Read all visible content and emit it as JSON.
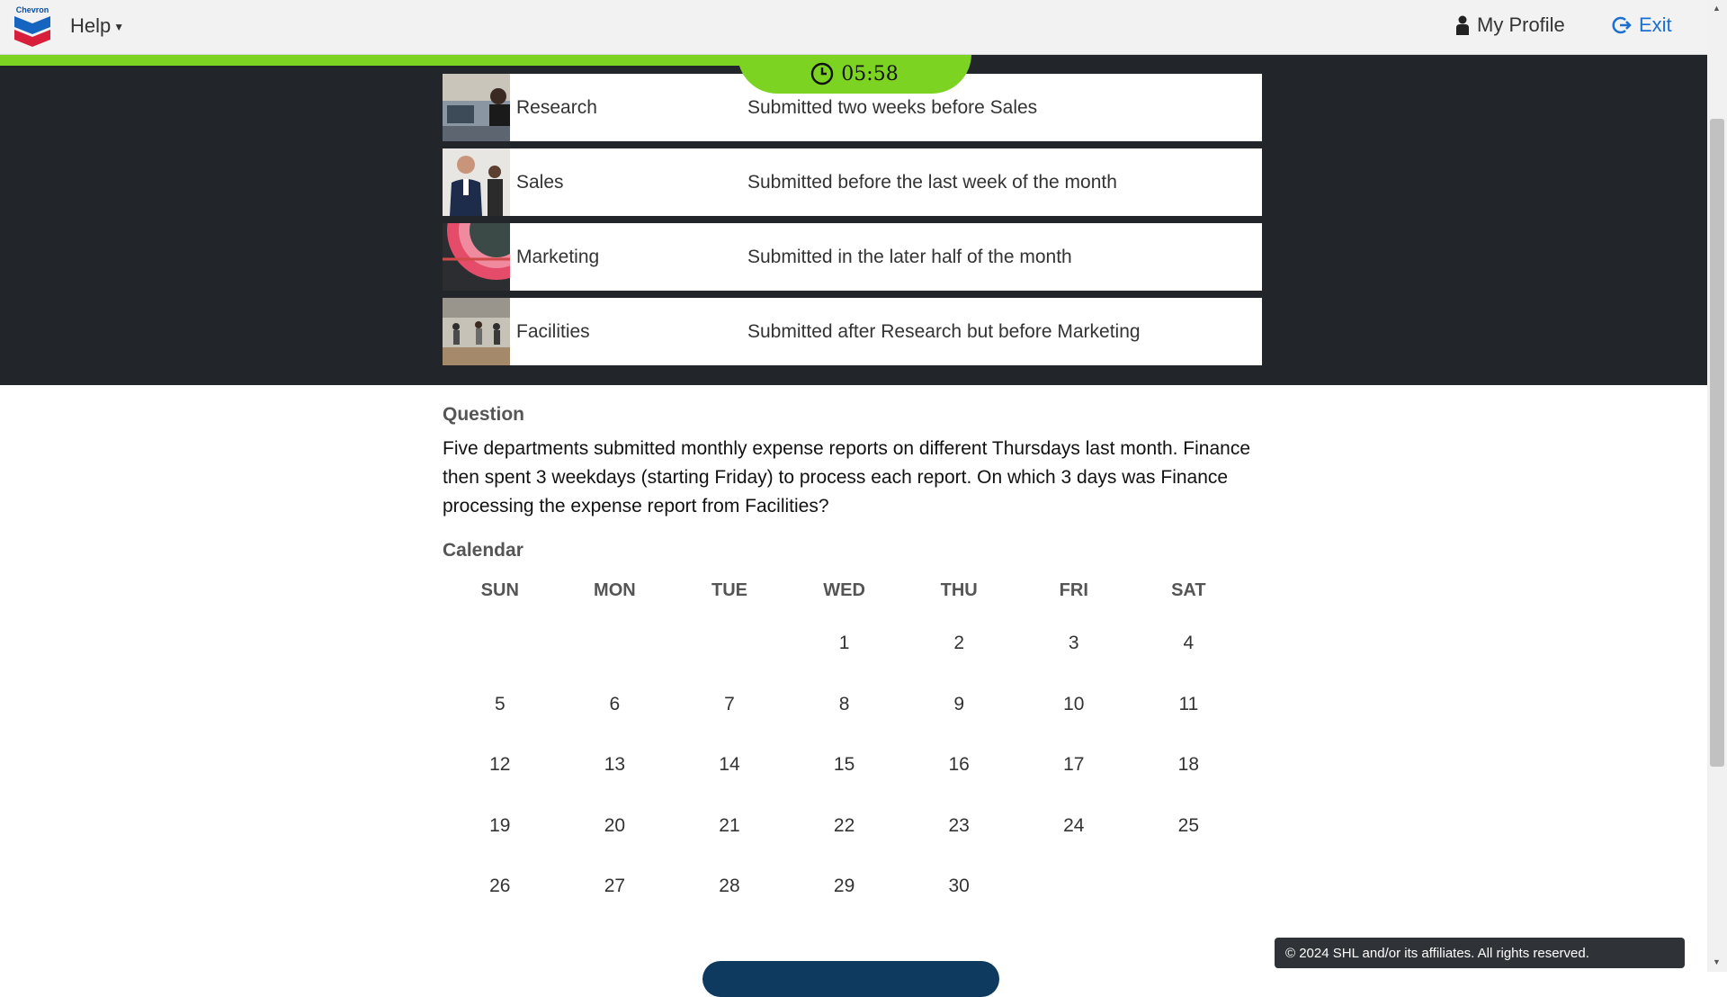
{
  "header": {
    "logo_text": "Chevron",
    "help_label": "Help",
    "profile_label": "My Profile",
    "exit_label": "Exit"
  },
  "timer": {
    "value": "05:58"
  },
  "departments": [
    {
      "name": "Research",
      "condition": "Submitted two weeks before Sales",
      "image": "office-workers-photo"
    },
    {
      "name": "Sales",
      "condition": "Submitted before the last week of the month",
      "image": "businessman-photo"
    },
    {
      "name": "Marketing",
      "condition": "Submitted in the later half of the month",
      "image": "color-wheel-photo"
    },
    {
      "name": "Facilities",
      "condition": "Submitted after Research but before Marketing",
      "image": "lobby-photo"
    }
  ],
  "question": {
    "label": "Question",
    "text": "Five departments submitted monthly expense reports on different Thursdays last month. Finance then spent 3 weekdays (starting Friday) to process each report. On which 3 days was Finance processing the expense report from Facilities?"
  },
  "calendar": {
    "label": "Calendar",
    "days": [
      "SUN",
      "MON",
      "TUE",
      "WED",
      "THU",
      "FRI",
      "SAT"
    ],
    "cells": [
      "",
      "",
      "",
      "1",
      "2",
      "3",
      "4",
      "5",
      "6",
      "7",
      "8",
      "9",
      "10",
      "11",
      "12",
      "13",
      "14",
      "15",
      "16",
      "17",
      "18",
      "19",
      "20",
      "21",
      "22",
      "23",
      "24",
      "25",
      "26",
      "27",
      "28",
      "29",
      "30",
      "",
      ""
    ]
  },
  "footer": {
    "copyright": "© 2024 SHL and/or its affiliates. All rights reserved."
  },
  "colors": {
    "accent_green": "#7dd321",
    "dark_band": "#222529",
    "link_blue": "#1a6fd1",
    "button_navy": "#0d3a5e"
  }
}
